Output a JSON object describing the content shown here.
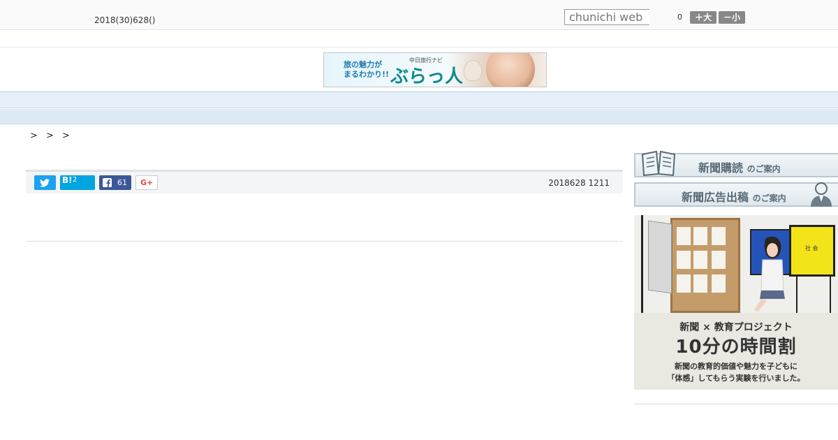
{
  "header": {
    "date": "2018(30)628()",
    "search_placeholder": "chunichi web",
    "counter": "0",
    "font_larger": "＋大",
    "font_smaller": "－小"
  },
  "banner": {
    "copy_line1": "旅の魅力が",
    "copy_line2": "まるわかり!!",
    "sub": "中日旅行ナビ",
    "brand": "ぶらっ人"
  },
  "nav": {
    "items": [
      "",
      "",
      "",
      "",
      "",
      "",
      "",
      "",
      ""
    ]
  },
  "breadcrumb": "> > >",
  "share": {
    "hatena_label": "B!",
    "hatena_count": "2",
    "facebook_count": "61",
    "gplus_label": "G+",
    "timestamp": "2018628 1211"
  },
  "sidebar": {
    "subscribe_main": "新聞購読",
    "subscribe_tail": "のご案内",
    "ad_main": "新聞広告出稿",
    "ad_tail": "のご案内",
    "promo": {
      "screen_text": "社 会",
      "line1": "新聞 × 教育プロジェクト",
      "line2": "10分の時間割",
      "line3": "新聞の教育的価値や魅力を子どもに",
      "line4": "「体感」してもらう実験を行いました。"
    }
  },
  "colors": {
    "twitter": "#1da1f2",
    "hatena": "#00a4de",
    "facebook": "#3b5998",
    "nav_bg": "#e6f0fa"
  }
}
